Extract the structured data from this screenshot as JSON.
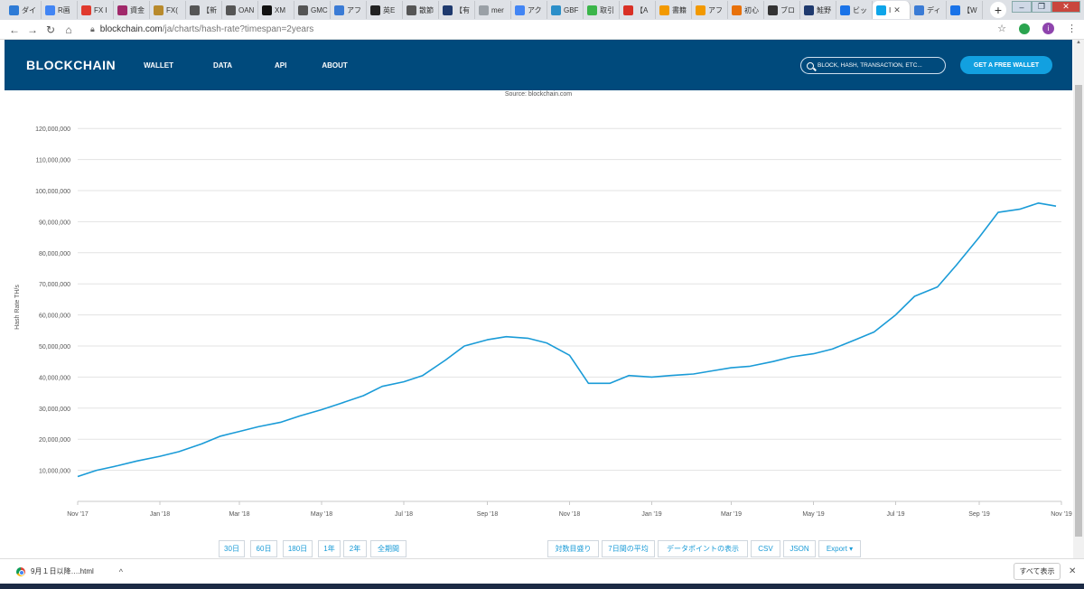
{
  "browser": {
    "tabs": [
      {
        "label": "ダイ",
        "color": "#2e7bd6"
      },
      {
        "label": "R画",
        "color": "#4285f4"
      },
      {
        "label": "FX I",
        "color": "#e03a2e"
      },
      {
        "label": "資金",
        "color": "#a0286a"
      },
      {
        "label": "FX(",
        "color": "#b88a2c"
      },
      {
        "label": "【新",
        "color": "#555555"
      },
      {
        "label": "OAN",
        "color": "#555555"
      },
      {
        "label": "XM",
        "color": "#111111"
      },
      {
        "label": "GMC",
        "color": "#555555"
      },
      {
        "label": "アフ",
        "color": "#3a7bd5"
      },
      {
        "label": "英E",
        "color": "#222222"
      },
      {
        "label": "散節",
        "color": "#555555"
      },
      {
        "label": "【有",
        "color": "#1f3a6e"
      },
      {
        "label": "mer",
        "color": "#9aa0a6"
      },
      {
        "label": "アク",
        "color": "#4285f4"
      },
      {
        "label": "GBF",
        "color": "#2b8fc9"
      },
      {
        "label": "取引",
        "color": "#3bb54a"
      },
      {
        "label": "【A",
        "color": "#d93025"
      },
      {
        "label": "書籍",
        "color": "#f29900"
      },
      {
        "label": "アフ",
        "color": "#f29900"
      },
      {
        "label": "初心",
        "color": "#e8710a"
      },
      {
        "label": "ブロ",
        "color": "#333333"
      },
      {
        "label": "鮭野",
        "color": "#1f3a6e"
      },
      {
        "label": "ビッ",
        "color": "#1a73e8"
      },
      {
        "label": "I",
        "color": "#0ea5e9"
      },
      {
        "label": "ディ",
        "color": "#3a7bd5"
      },
      {
        "label": "【W",
        "color": "#1a73e8"
      }
    ],
    "url_host": "blockchain.com",
    "url_path": "/ja/charts/hash-rate?timespan=2years"
  },
  "site": {
    "logo": "BLOCKCHAIN",
    "nav": [
      "WALLET",
      "DATA",
      "API",
      "ABOUT"
    ],
    "search_placeholder": "BLOCK, HASH, TRANSACTION, ETC...",
    "cta": "GET A FREE WALLET"
  },
  "chart_data": {
    "type": "line",
    "source": "Source: blockchain.com",
    "ylabel": "Hash Rate TH/s",
    "ylim": [
      0,
      125000000
    ],
    "y_ticks": [
      "10,000,000",
      "20,000,000",
      "30,000,000",
      "40,000,000",
      "50,000,000",
      "60,000,000",
      "70,000,000",
      "80,000,000",
      "90,000,000",
      "100,000,000",
      "110,000,000",
      "120,000,000"
    ],
    "x_ticks": [
      "Nov '17",
      "Jan '18",
      "Mar '18",
      "May '18",
      "Jul '18",
      "Sep '18",
      "Nov '18",
      "Jan '19",
      "Mar '19",
      "May '19",
      "Jul '19",
      "Sep '19",
      "Nov '19"
    ],
    "x_tick_dates": [
      "2017-11-01",
      "2018-01-01",
      "2018-03-01",
      "2018-05-01",
      "2018-07-01",
      "2018-09-01",
      "2018-11-01",
      "2019-01-01",
      "2019-03-01",
      "2019-05-01",
      "2019-07-01",
      "2019-09-01",
      "2019-11-01"
    ],
    "color": "#1a9bd7",
    "series": [
      {
        "x": [
          "2017-11-01",
          "2017-11-15",
          "2017-12-01",
          "2017-12-15",
          "2018-01-01",
          "2018-01-15",
          "2018-02-01",
          "2018-02-15",
          "2018-03-01",
          "2018-03-15",
          "2018-04-01",
          "2018-04-15",
          "2018-05-01",
          "2018-05-15",
          "2018-06-01",
          "2018-06-15",
          "2018-07-01",
          "2018-07-15",
          "2018-08-01",
          "2018-08-15",
          "2018-09-01",
          "2018-09-15",
          "2018-10-01",
          "2018-10-15",
          "2018-11-01",
          "2018-11-15",
          "2018-12-01",
          "2018-12-15",
          "2019-01-01",
          "2019-01-15",
          "2019-02-01",
          "2019-02-15",
          "2019-03-01",
          "2019-03-15",
          "2019-04-01",
          "2019-04-15",
          "2019-05-01",
          "2019-05-15",
          "2019-06-01",
          "2019-06-15",
          "2019-07-01",
          "2019-07-15",
          "2019-08-01",
          "2019-08-15",
          "2019-09-01",
          "2019-09-15",
          "2019-10-01",
          "2019-10-15",
          "2019-10-28"
        ],
        "values": [
          8000000,
          10000000,
          11500000,
          13000000,
          14500000,
          16000000,
          18500000,
          21000000,
          22500000,
          24000000,
          25500000,
          27500000,
          29500000,
          31500000,
          34000000,
          37000000,
          38500000,
          40500000,
          45500000,
          50000000,
          52000000,
          53000000,
          52500000,
          51000000,
          47000000,
          38000000,
          38000000,
          40500000,
          40000000,
          40500000,
          41000000,
          42000000,
          43000000,
          43500000,
          45000000,
          46500000,
          47500000,
          49000000,
          52000000,
          54500000,
          60000000,
          66000000,
          69000000,
          76000000,
          85000000,
          93000000,
          94000000,
          96000000,
          95000000
        ]
      }
    ],
    "range_buttons": [
      "30日",
      "60日",
      "180日",
      "1年",
      "2年",
      "全期間"
    ],
    "option_buttons": [
      "対数目盛り",
      "7日間の平均",
      "データポイントの表示",
      "CSV",
      "JSON",
      "Export ▾"
    ]
  },
  "download_bar": {
    "file": "9月１日以降….html",
    "show_all": "すべて表示"
  }
}
